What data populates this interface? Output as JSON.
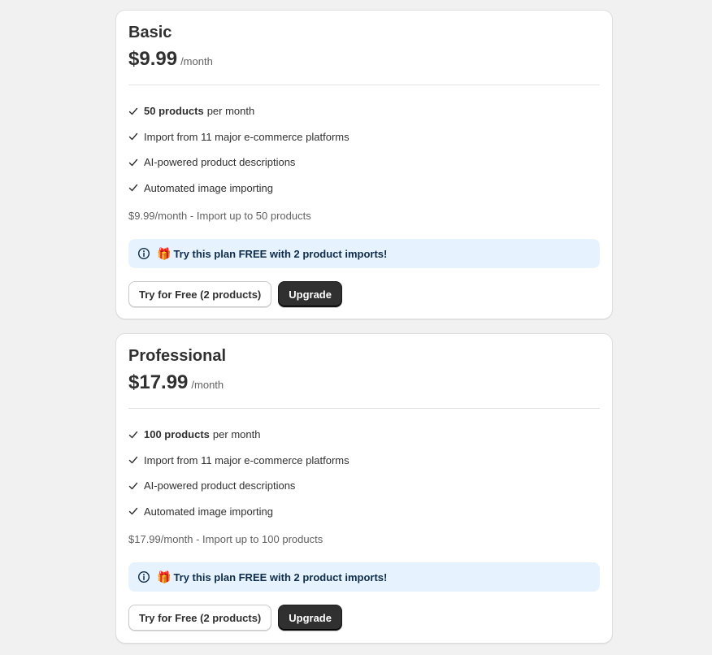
{
  "plans": [
    {
      "name": "Basic",
      "price": "$9.99",
      "period": "/month",
      "features": [
        {
          "bold": "50 products",
          "text": "per month"
        },
        {
          "bold": "",
          "text": "Import from 11 major e-commerce platforms"
        },
        {
          "bold": "",
          "text": "AI-powered product descriptions"
        },
        {
          "bold": "",
          "text": "Automated image importing"
        }
      ],
      "summary": "$9.99/month - Import up to 50 products",
      "banner": {
        "gift": "🎁",
        "text": "Try this plan FREE with 2 product imports!"
      },
      "trial_button": "Try for Free (2 products)",
      "upgrade_button": "Upgrade"
    },
    {
      "name": "Professional",
      "price": "$17.99",
      "period": "/month",
      "features": [
        {
          "bold": "100 products",
          "text": "per month"
        },
        {
          "bold": "",
          "text": "Import from 11 major e-commerce platforms"
        },
        {
          "bold": "",
          "text": "AI-powered product descriptions"
        },
        {
          "bold": "",
          "text": "Automated image importing"
        }
      ],
      "summary": "$17.99/month - Import up to 100 products",
      "banner": {
        "gift": "🎁",
        "text": "Try this plan FREE with 2 product imports!"
      },
      "trial_button": "Try for Free (2 products)",
      "upgrade_button": "Upgrade"
    }
  ],
  "icons": {
    "check": "check-icon",
    "info": "info-icon",
    "gift": "gift-icon"
  },
  "colors": {
    "background": "#f1f1f1",
    "primary_button": "#303030",
    "banner_bg": "#e6f2fd",
    "banner_text": "#0f2d4a"
  }
}
